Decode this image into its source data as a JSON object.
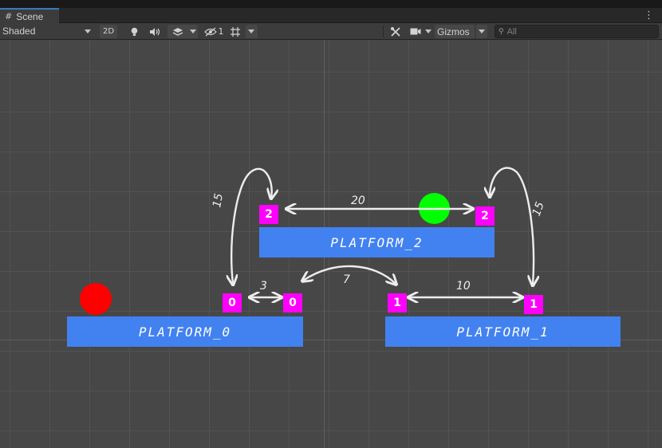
{
  "window": {
    "tab_label": "Scene",
    "tab_icon": "#",
    "menu_icon": "⋮"
  },
  "toolbar": {
    "shading_mode": "Shaded",
    "toggle_2d_label": "2D",
    "hidden_count": "1",
    "gizmos_label": "Gizmos",
    "search_placeholder": "All",
    "icons": [
      "lightbulb-icon",
      "audio-icon",
      "effects-icon",
      "visibility-icon",
      "grid-snap-icon",
      "tools-icon",
      "camera-icon",
      "search-icon"
    ]
  },
  "scene": {
    "platforms": [
      {
        "name": "PLATFORM_0",
        "color": "#4281f0"
      },
      {
        "name": "PLATFORM_1",
        "color": "#4281f0"
      },
      {
        "name": "PLATFORM_2",
        "color": "#4281f0"
      }
    ],
    "nodes": [
      "0",
      "0",
      "1",
      "1",
      "2",
      "2"
    ],
    "node_color": "#ff00ff",
    "edge_costs": {
      "p0_left_to_p2_left": "15",
      "p0_nodes": "3",
      "p0_to_p1": "7",
      "p1_nodes": "10",
      "p2_nodes": "20",
      "p1_right_to_p2_right": "15"
    },
    "red_ball_color": "#ff0000",
    "green_ball_color": "#00ff00"
  }
}
